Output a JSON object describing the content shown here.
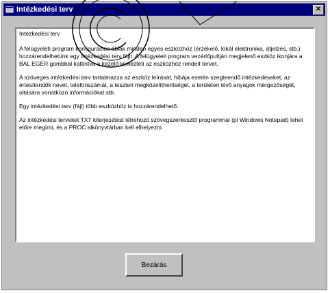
{
  "window": {
    "title": "Intézkedési terv",
    "close_label": "✕"
  },
  "content": {
    "heading": "Intézkedési terv",
    "paragraphs": [
      "A felügyeleti program konfigurációs ablak minden egyes eszközhöz (érzékelő, lokál elektronika, átjelzés, stb.) hozzárendelhetünk egy intézkedési terv fájlt. A felügyeleti program vezérlőpultján megjelenő eszköz ikonjára a BAL EGÉR gombbal kattintva a kezelő kijelezteti az eszközhöz rendelt tervet.",
      "A szöveges intézkedési terv tartalmazza az eszköz leírását, hibája esetén szegteendő intézkedéseket, az értesítendők nevét, telefonszámát, a teszteri megközelíthetőségét, a területen lévő anyagok mérgezőségét, oltására vonatkozó információkat stb.",
      "Egy intézkedési terv (fájl) több eszközhöz is hozzárendelhető.",
      "Az intézkedési terveket TXT kiterjesztést létrehozó szövegszerkesztő programmal (pl Windows Notepad) lehet előre megírni, és a PROC alkönyvtárban kell elhelyezni."
    ]
  },
  "buttons": {
    "ok_label": "Bezárás"
  }
}
